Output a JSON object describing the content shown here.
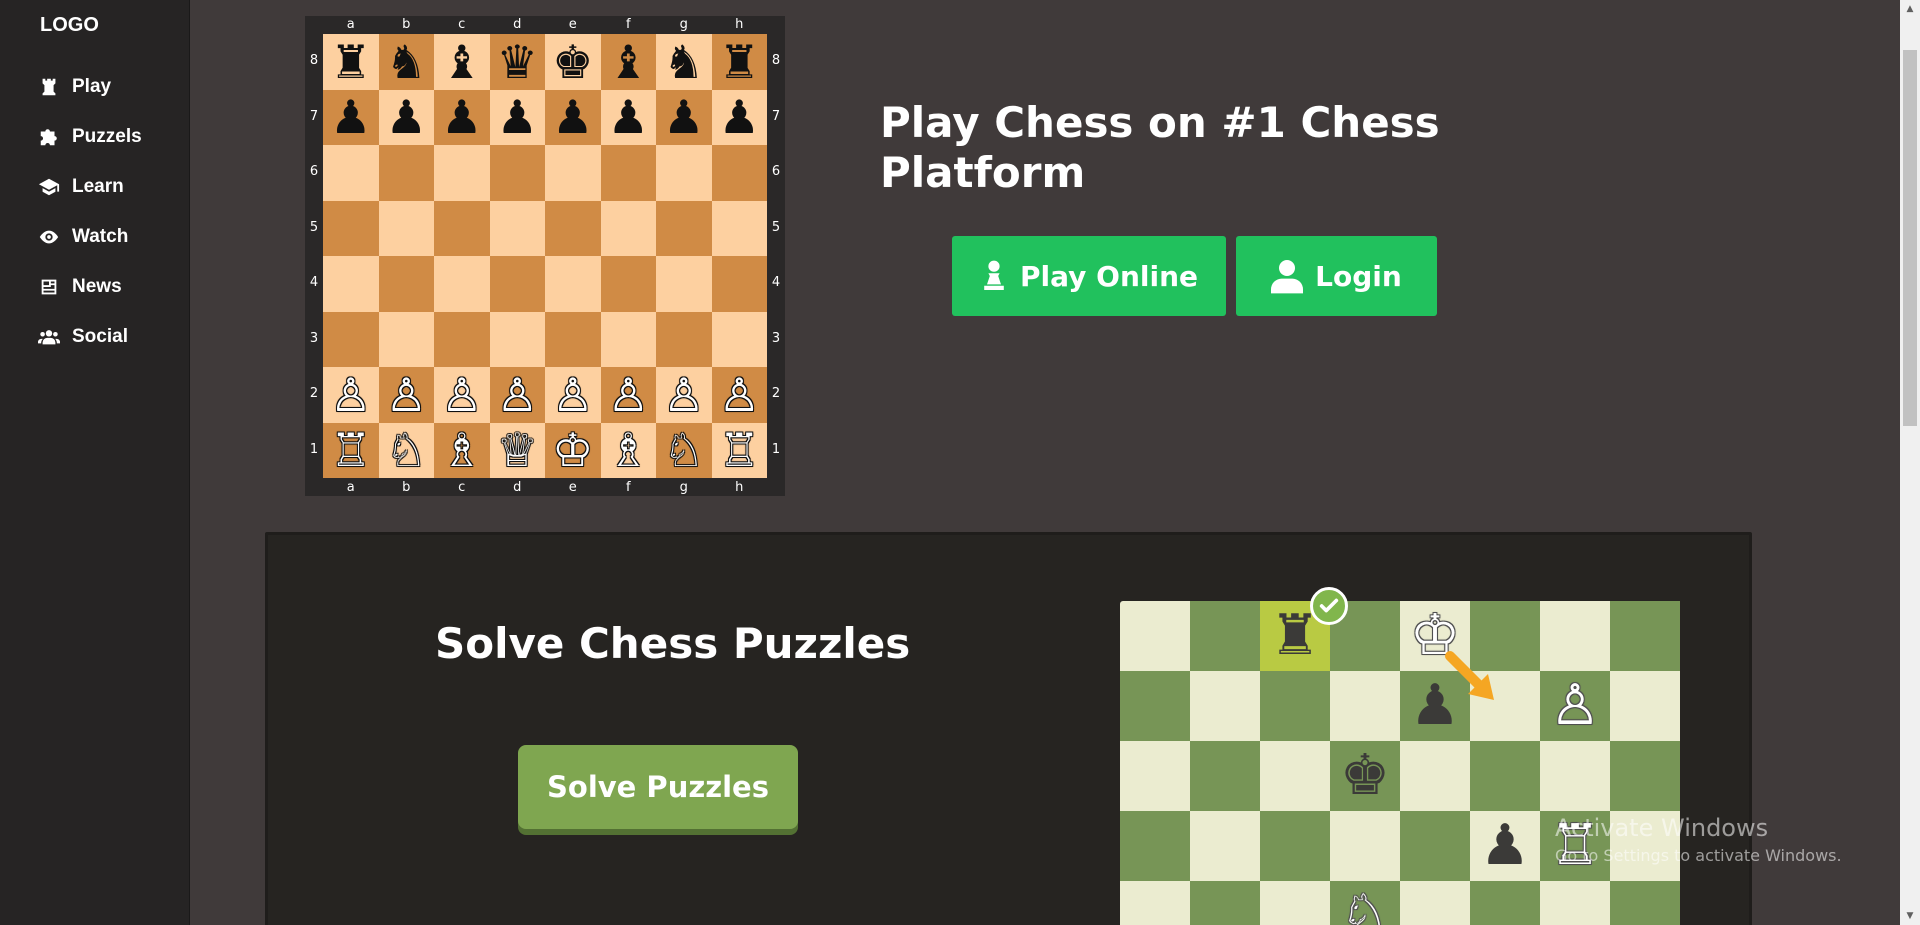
{
  "sidebar": {
    "logo": "LOGO",
    "items": [
      {
        "label": "Play",
        "icon": "chess-rook-icon"
      },
      {
        "label": "Puzzels",
        "icon": "puzzle-piece-icon"
      },
      {
        "label": "Learn",
        "icon": "graduation-cap-icon"
      },
      {
        "label": "Watch",
        "icon": "eye-icon"
      },
      {
        "label": "News",
        "icon": "newspaper-icon"
      },
      {
        "label": "Social",
        "icon": "users-icon"
      }
    ]
  },
  "board": {
    "files": [
      "a",
      "b",
      "c",
      "d",
      "e",
      "f",
      "g",
      "h"
    ],
    "ranks": [
      "8",
      "7",
      "6",
      "5",
      "4",
      "3",
      "2",
      "1"
    ],
    "position": [
      [
        "♜",
        "♞",
        "♝",
        "♛",
        "♚",
        "♝",
        "♞",
        "♜"
      ],
      [
        "♟",
        "♟",
        "♟",
        "♟",
        "♟",
        "♟",
        "♟",
        "♟"
      ],
      [
        "",
        "",
        "",
        "",
        "",
        "",
        "",
        ""
      ],
      [
        "",
        "",
        "",
        "",
        "",
        "",
        "",
        ""
      ],
      [
        "",
        "",
        "",
        "",
        "",
        "",
        "",
        ""
      ],
      [
        "",
        "",
        "",
        "",
        "",
        "",
        "",
        ""
      ],
      [
        "♙",
        "♙",
        "♙",
        "♙",
        "♙",
        "♙",
        "♙",
        "♙"
      ],
      [
        "♖",
        "♘",
        "♗",
        "♕",
        "♔",
        "♗",
        "♘",
        "♖"
      ]
    ],
    "light_color": "#fdd0a0",
    "dark_color": "#d08b45"
  },
  "hero": {
    "title": "Play Chess on #1 Chess Platform",
    "play_online_label": "Play Online",
    "login_label": "Login",
    "button_color": "#21c15d"
  },
  "puzzles": {
    "title": "Solve Chess Puzzles",
    "button_label": "Solve Puzzles",
    "button_color": "#7fa650",
    "board_pieces": [
      [
        "",
        "",
        "b:♜",
        "",
        "w:♔",
        "",
        "",
        ""
      ],
      [
        "",
        "",
        "",
        "",
        "b:♟",
        "",
        "w:♙",
        ""
      ],
      [
        "",
        "",
        "",
        "b:♚",
        "",
        "",
        "",
        ""
      ],
      [
        "",
        "",
        "",
        "",
        "",
        "b:♟",
        "w:♖",
        ""
      ],
      [
        "",
        "",
        "",
        "w:♘",
        "",
        "",
        "",
        ""
      ]
    ],
    "highlight_square": [
      0,
      2
    ]
  },
  "watermark": {
    "line1": "Activate Windows",
    "line2": "Go to Settings to activate Windows."
  }
}
